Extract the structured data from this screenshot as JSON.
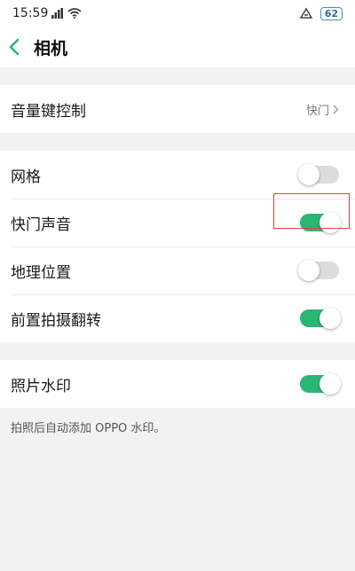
{
  "status_bar": {
    "time": "15:59",
    "battery": "62"
  },
  "header": {
    "title": "相机"
  },
  "sections": [
    {
      "rows": [
        {
          "label": "音量键控制",
          "type": "value",
          "value": "快门"
        }
      ]
    },
    {
      "rows": [
        {
          "label": "网格",
          "type": "toggle",
          "on": false
        },
        {
          "label": "快门声音",
          "type": "toggle",
          "on": true
        },
        {
          "label": "地理位置",
          "type": "toggle",
          "on": false
        },
        {
          "label": "前置拍摄翻转",
          "type": "toggle",
          "on": true
        }
      ]
    },
    {
      "rows": [
        {
          "label": "照片水印",
          "type": "toggle",
          "on": true
        }
      ]
    }
  ],
  "footer_note": "拍照后自动添加 OPPO 水印。",
  "colors": {
    "toggle_on": "#2cb673",
    "toggle_off": "#dcdcdc",
    "highlight": "#e0423a"
  }
}
